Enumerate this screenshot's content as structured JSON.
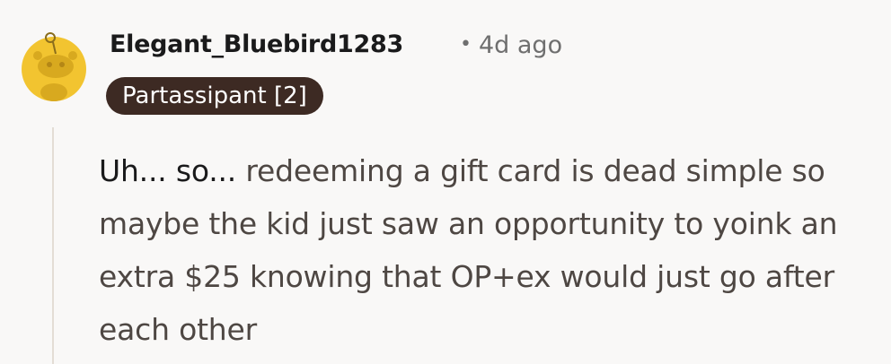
{
  "comment": {
    "author": "Elegant_Bluebird1283",
    "separator": "•",
    "time_ago": "4d ago",
    "flair": "Partassipant [2]",
    "avatar_icon": "snoo-avatar-icon",
    "body_start": "Uh... so...",
    "body_rest": "redeeming a gift card is dead simple so maybe the kid just saw an opportunity to yoink an extra $25 knowing that OP+ex would just go after each other"
  },
  "colors": {
    "background": "#f9f8f7",
    "avatar_yellow": "#f2c430",
    "flair_background": "#3d2a23",
    "thread_line": "#e3ddd5"
  }
}
